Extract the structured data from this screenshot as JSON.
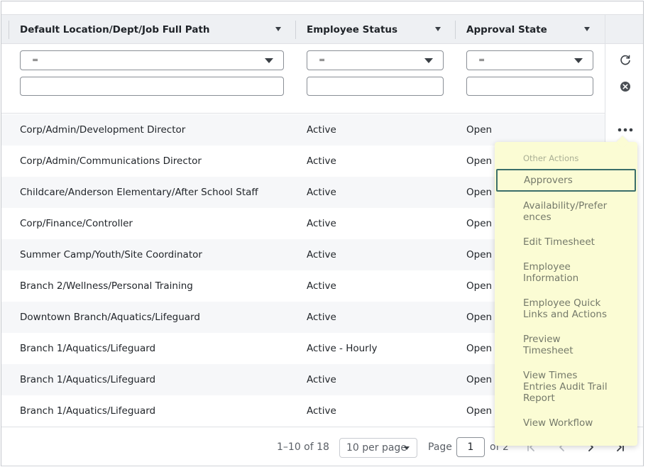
{
  "columns": [
    {
      "label": "Default Location/Dept/Job Full Path"
    },
    {
      "label": "Employee Status"
    },
    {
      "label": "Approval State"
    }
  ],
  "filters": [
    {
      "operator": "=",
      "value": ""
    },
    {
      "operator": "=",
      "value": ""
    },
    {
      "operator": "=",
      "value": ""
    }
  ],
  "rows": [
    {
      "path": "Corp/Admin/Development Director",
      "status": "Active",
      "approval": "Open"
    },
    {
      "path": "Corp/Admin/Communications Director",
      "status": "Active",
      "approval": "Open"
    },
    {
      "path": "Childcare/Anderson Elementary/After School Staff",
      "status": "Active",
      "approval": "Open"
    },
    {
      "path": "Corp/Finance/Controller",
      "status": "Active",
      "approval": "Open"
    },
    {
      "path": "Summer Camp/Youth/Site Coordinator",
      "status": "Active",
      "approval": "Open"
    },
    {
      "path": "Branch 2/Wellness/Personal Training",
      "status": "Active",
      "approval": "Open"
    },
    {
      "path": "Downtown Branch/Aquatics/Lifeguard",
      "status": "Active",
      "approval": "Open"
    },
    {
      "path": "Branch 1/Aquatics/Lifeguard",
      "status": "Active - Hourly",
      "approval": "Open"
    },
    {
      "path": "Branch 1/Aquatics/Lifeguard",
      "status": "Active",
      "approval": "Open"
    },
    {
      "path": "Branch 1/Aquatics/Lifeguard",
      "status": "Active",
      "approval": "Open"
    }
  ],
  "pagination": {
    "range": "1–10 of 18",
    "per_page": "10 per page",
    "page_label": "Page",
    "current_page": "1",
    "of_label": "of 2"
  },
  "menu": {
    "title": "Other Actions",
    "items": [
      {
        "label": "Approvers",
        "selected": true
      },
      {
        "label": "Availability/Prefer\nences"
      },
      {
        "label": "Edit Timesheet"
      },
      {
        "label": "Employee\nInformation"
      },
      {
        "label": "Employee Quick\nLinks and Actions"
      },
      {
        "label": "Preview\nTimesheet"
      },
      {
        "label": "View Times\nEntries Audit Trail\nReport"
      },
      {
        "label": "View Workflow"
      }
    ]
  },
  "icons": {
    "refresh": "refresh-icon",
    "clear": "clear-filter-icon",
    "more": "more-actions-icon",
    "first": "first-page-icon",
    "prev": "previous-page-icon",
    "next": "next-page-icon",
    "last": "last-page-icon"
  },
  "colors": {
    "menu_background": "#fbfcd4",
    "selected_outline": "#3a6e6a",
    "header_background": "#eef0f3"
  }
}
